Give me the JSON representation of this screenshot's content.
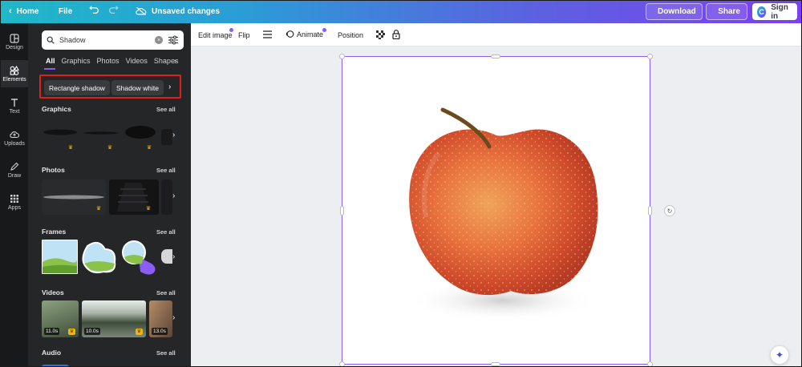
{
  "topbar": {
    "home_label": "Home",
    "file_label": "File",
    "unsaved_label": "Unsaved changes",
    "download_label": "Download",
    "share_label": "Share",
    "signin_label": "Sign in",
    "logo_letter": "C"
  },
  "rail": {
    "items": [
      {
        "label": "Design",
        "icon": "design-icon"
      },
      {
        "label": "Elements",
        "icon": "elements-icon",
        "active": true
      },
      {
        "label": "Text",
        "icon": "text-icon"
      },
      {
        "label": "Uploads",
        "icon": "uploads-icon"
      },
      {
        "label": "Draw",
        "icon": "draw-icon"
      },
      {
        "label": "Apps",
        "icon": "apps-icon"
      }
    ]
  },
  "panel": {
    "search_value": "Shadow",
    "tabs": [
      "All",
      "Graphics",
      "Photos",
      "Videos",
      "Shapes"
    ],
    "chips": [
      "Rectangle shadow",
      "Shadow white"
    ],
    "sections": {
      "graphics": "Graphics",
      "photos": "Photos",
      "frames": "Frames",
      "videos": "Videos",
      "audio": "Audio"
    },
    "see_all": "See all",
    "video_durations": [
      "11.0s",
      "10.0s",
      "13.0s"
    ]
  },
  "context_toolbar": {
    "edit_image": "Edit image",
    "flip": "Flip",
    "animate": "Animate",
    "position": "Position"
  },
  "colors": {
    "accent": "#8b5cf6",
    "highlight_border": "#e0201b",
    "panel_bg": "#252627",
    "rail_bg": "#18191b",
    "canvas_bg": "#eceef1"
  }
}
